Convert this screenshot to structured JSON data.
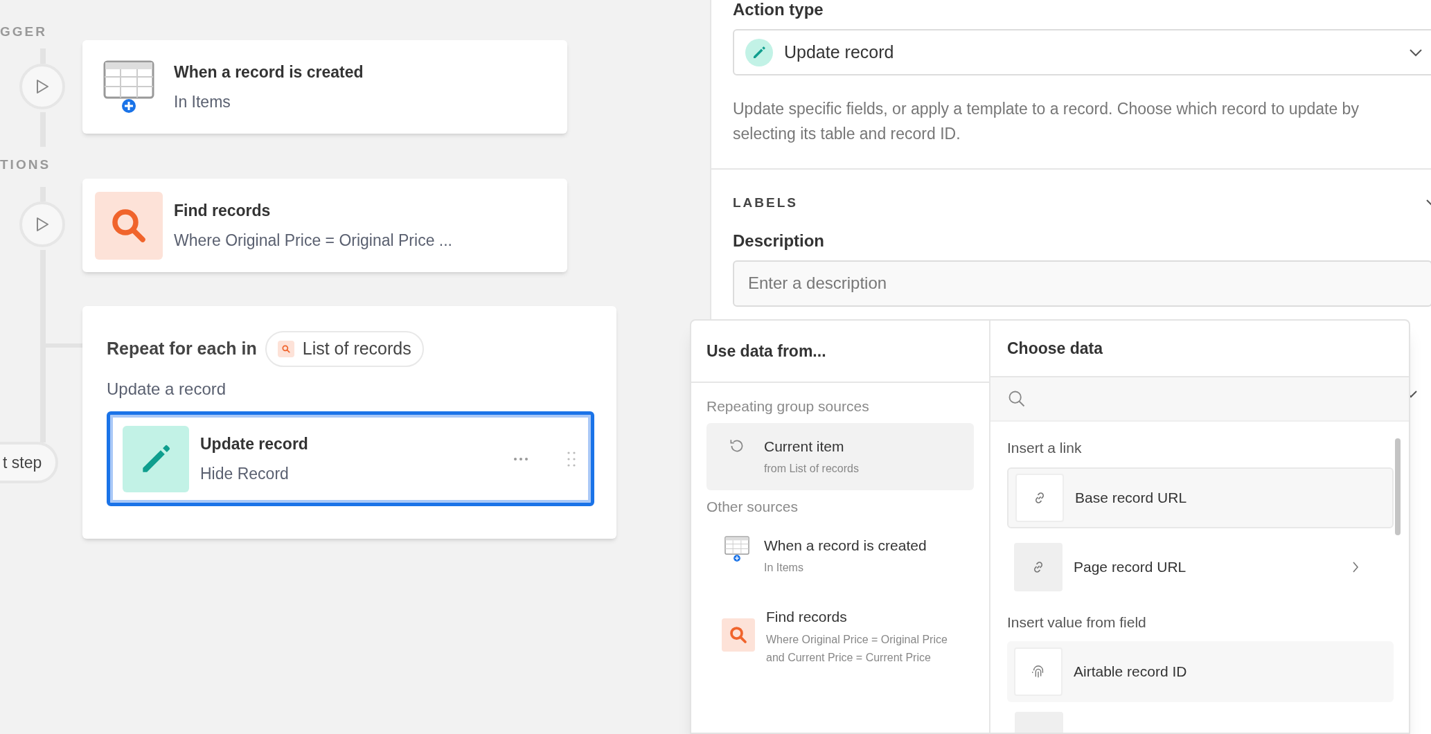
{
  "canvas": {
    "section_labels": [
      "GGER",
      "TIONS"
    ],
    "steps": [
      {
        "kind": "trigger",
        "title": "When a record is created",
        "subtitle": "In Items"
      },
      {
        "kind": "find",
        "title": "Find records",
        "subtitle": "Where Original Price = Original Price ..."
      }
    ],
    "repeat": {
      "title": "Repeat for each in",
      "source": "List of records",
      "subtitle": "Update a record",
      "step": {
        "title": "Update record",
        "subtitle": "Hide Record",
        "selected": true
      }
    },
    "add_step_button": "t step"
  },
  "panel": {
    "action_type_label": "Action type",
    "action_type": "Update record",
    "help": "Update specific fields, or apply a template to a record. Choose which record to update by selecting its table and record ID.",
    "labels_heading": "LABELS",
    "description_label": "Description",
    "description_placeholder": "Enter a description"
  },
  "data_picker": {
    "left_title": "Use data from...",
    "right_title": "Choose data",
    "groups": [
      {
        "heading": "Repeating group sources",
        "items": [
          {
            "kind": "repeat",
            "title": "Current item",
            "subtitle": "from List of records",
            "selected": true
          }
        ]
      },
      {
        "heading": "Other sources",
        "items": [
          {
            "kind": "trigger",
            "title": "When a record is created",
            "subtitle": "In Items",
            "selected": false
          },
          {
            "kind": "find",
            "title": "Find records",
            "subtitle": "Where Original Price = Original Price and Current Price = Current Price",
            "selected": false
          }
        ]
      }
    ],
    "sections": [
      {
        "heading": "Insert a link",
        "items": [
          {
            "kind": "link",
            "label": "Base record URL",
            "selected": true,
            "submenu": false
          },
          {
            "kind": "link",
            "label": "Page record URL",
            "selected": false,
            "submenu": true
          }
        ]
      },
      {
        "heading": "Insert value from field",
        "items": [
          {
            "kind": "id",
            "label": "Airtable record ID",
            "selected": false,
            "submenu": false
          }
        ]
      }
    ]
  }
}
